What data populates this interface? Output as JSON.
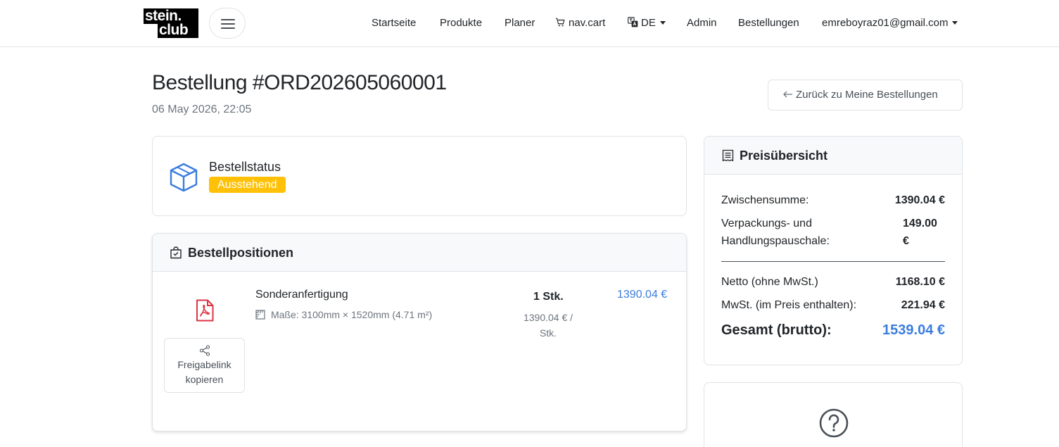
{
  "nav": {
    "logo_line1": "stein.",
    "logo_line2": "club",
    "items": [
      {
        "label": "Startseite"
      },
      {
        "label": "Produkte"
      },
      {
        "label": "Planer"
      },
      {
        "label": "nav.cart"
      },
      {
        "label": "DE"
      },
      {
        "label": "Admin"
      },
      {
        "label": "Bestellungen"
      },
      {
        "label": "emreboyraz01@gmail.com"
      }
    ]
  },
  "header": {
    "title": "Bestellung #ORD202605060001",
    "date": "06 May 2026, 22:05",
    "back_label": "Zurück zu Meine Bestellungen"
  },
  "status": {
    "title": "Bestellstatus",
    "badge": "Ausstehend",
    "badge_color": "#ffc107"
  },
  "items": {
    "title": "Bestellpositionen",
    "rows": [
      {
        "name": "Sonderanfertigung",
        "dimensions": "Maße: 3100mm × 1520mm (4.71 m²)",
        "quantity": "1 Stk.",
        "unit_price": "1390.04 € / Stk.",
        "price": "1390.04 €",
        "share_label": "Freigabelink kopieren"
      }
    ]
  },
  "price": {
    "title": "Preisübersicht",
    "subtotal_label": "Zwischensumme:",
    "subtotal_value": "1390.04 €",
    "packaging_label": "Verpackungs- und Handlungspauschale:",
    "packaging_value": "149.00 €",
    "net_label": "Netto (ohne MwSt.)",
    "net_value": "1168.10 €",
    "vat_label": "MwSt. (im Preis enthalten):",
    "vat_value": "221.94 €",
    "total_label": "Gesamt (brutto):",
    "total_value": "1539.04 €"
  },
  "colors": {
    "accent": "#3b7ddd",
    "pdf_red": "#dc3545",
    "badge": "#ffc107"
  },
  "icons": [
    "box-icon",
    "bag-check-icon",
    "pdf-icon",
    "share-icon",
    "ruler-icon",
    "receipt-icon",
    "question-circle-icon",
    "cart-icon",
    "translate-icon",
    "arrow-left-icon"
  ]
}
